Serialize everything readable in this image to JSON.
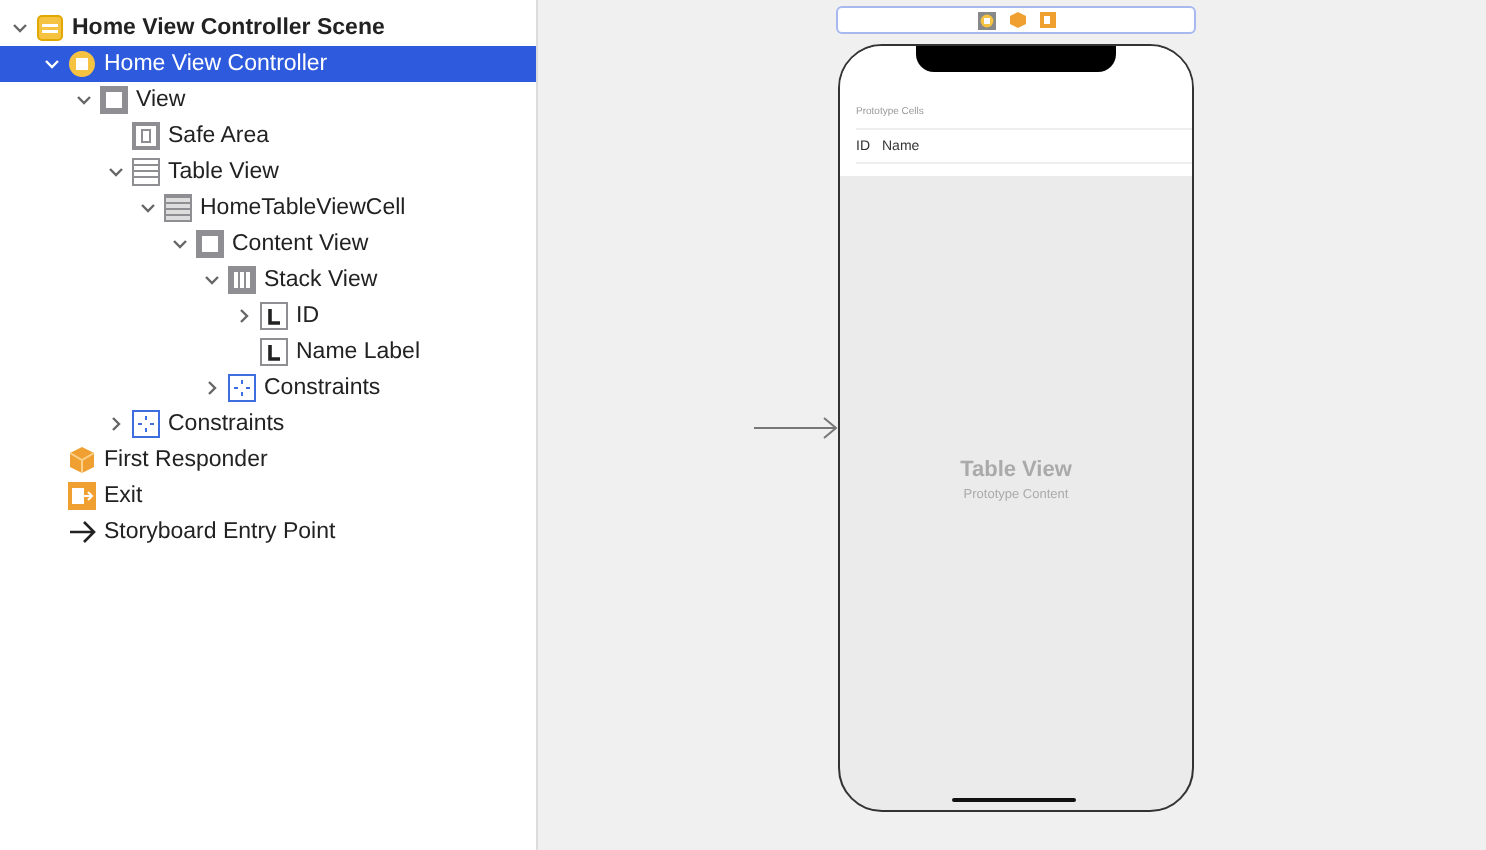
{
  "outline": [
    {
      "label": "Home View Controller Scene",
      "kind": "scene",
      "expanded": true,
      "selected": false,
      "children": [
        {
          "label": "Home View Controller",
          "kind": "controller",
          "expanded": true,
          "selected": true,
          "children": [
            {
              "label": "View",
              "kind": "view",
              "expanded": true,
              "selected": false,
              "children": [
                {
                  "label": "Safe Area",
                  "kind": "safearea",
                  "selected": false
                },
                {
                  "label": "Table View",
                  "kind": "table",
                  "expanded": true,
                  "selected": false,
                  "children": [
                    {
                      "label": "HomeTableViewCell",
                      "kind": "cell",
                      "expanded": true,
                      "selected": false,
                      "children": [
                        {
                          "label": "Content View",
                          "kind": "view",
                          "expanded": true,
                          "selected": false,
                          "children": [
                            {
                              "label": "Stack View",
                              "kind": "stack",
                              "expanded": true,
                              "selected": false,
                              "children": [
                                {
                                  "label": "ID",
                                  "kind": "label",
                                  "expanded": false,
                                  "selected": false
                                },
                                {
                                  "label": "Name Label",
                                  "kind": "label",
                                  "selected": false
                                }
                              ]
                            },
                            {
                              "label": "Constraints",
                              "kind": "constraints",
                              "expanded": false,
                              "selected": false
                            }
                          ]
                        }
                      ]
                    }
                  ]
                },
                {
                  "label": "Constraints",
                  "kind": "constraints",
                  "expanded": false,
                  "selected": false
                }
              ]
            }
          ]
        },
        {
          "label": "First Responder",
          "kind": "responder",
          "selected": false
        },
        {
          "label": "Exit",
          "kind": "exit",
          "selected": false
        },
        {
          "label": "Storyboard Entry Point",
          "kind": "arrow",
          "selected": false
        }
      ]
    }
  ],
  "canvas": {
    "section_header": "Prototype Cells",
    "cell_labels": [
      "ID",
      "Name"
    ],
    "table_title": "Table View",
    "table_subtitle": "Prototype Content"
  }
}
